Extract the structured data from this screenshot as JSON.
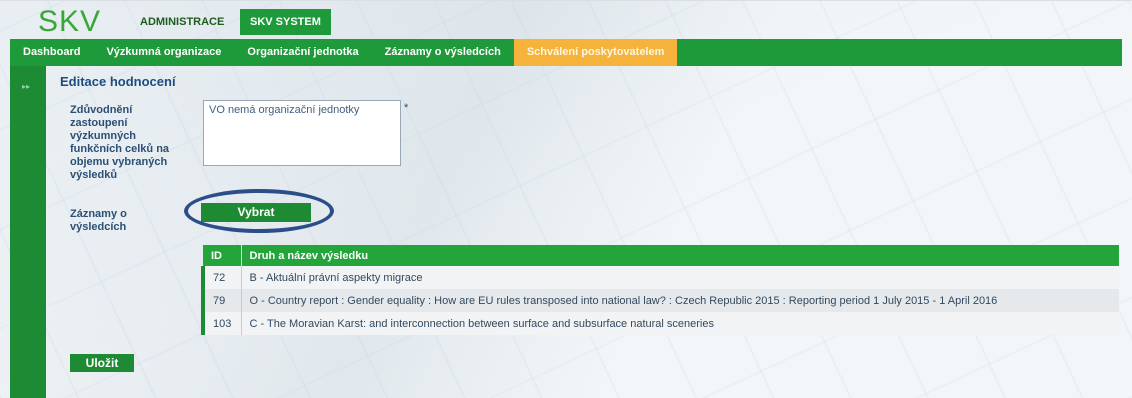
{
  "app": {
    "logo": "SKV"
  },
  "top_tabs": [
    {
      "label": "ADMINISTRACE"
    },
    {
      "label": "SKV SYSTEM",
      "active": true
    }
  ],
  "nav": {
    "items": [
      {
        "label": "Dashboard"
      },
      {
        "label": "Výzkumná organizace"
      },
      {
        "label": "Organizační jednotka"
      },
      {
        "label": "Záznamy o výsledcích"
      },
      {
        "label": "Schválení poskytovatelem",
        "active": true
      }
    ]
  },
  "sidebar": {
    "toggle_icon": "double-chevron-right-icon"
  },
  "page": {
    "title": "Editace hodnocení"
  },
  "form": {
    "justification_label": "Zdůvodnění zastoupení výzkumných funkčních celků na objemu vybraných výsledků",
    "justification_value": "VO nemá organizační jednotky",
    "required_mark": "*",
    "records_label": "Záznamy o výsledcích",
    "select_button": "Vybrat",
    "save_button": "Uložit"
  },
  "table": {
    "headers": [
      "ID",
      "Druh a název výsledku"
    ],
    "rows": [
      {
        "id": "72",
        "title": "B - Aktuální právní aspekty migrace"
      },
      {
        "id": "79",
        "title": "O - Country report : Gender equality : How are EU rules transposed into national law? : Czech Republic 2015 : Reporting period 1 July 2015 - 1 April 2016"
      },
      {
        "id": "103",
        "title": "C - The Moravian Karst: and interconnection between surface and subsurface natural sceneries"
      }
    ]
  },
  "colors": {
    "brand_green": "#1e9a3a",
    "active_nav": "#f6b33c",
    "annotation_ring": "#2b4d8a"
  }
}
